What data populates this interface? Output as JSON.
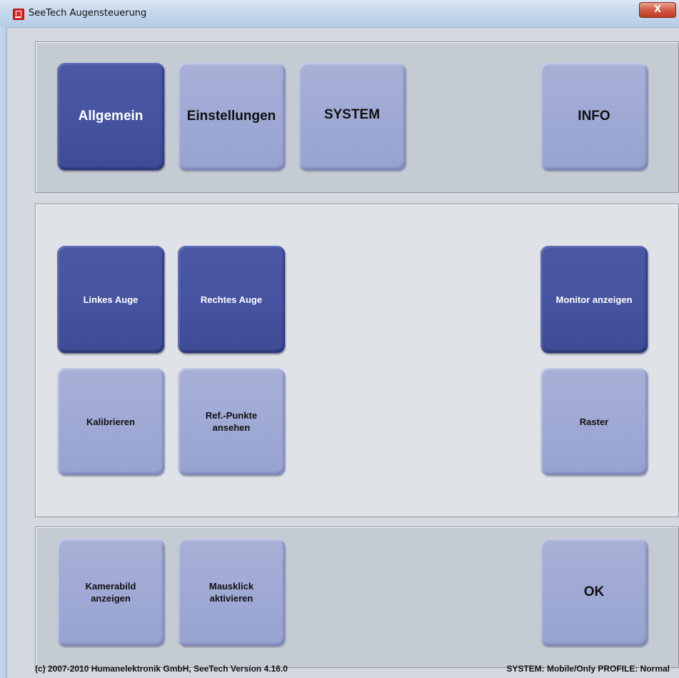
{
  "window": {
    "title": "SeeTech Augensteuerung",
    "close_label": "X"
  },
  "tabs": [
    {
      "label": "Allgemein",
      "active": true
    },
    {
      "label": "Einstellungen",
      "active": false
    },
    {
      "label": "SYSTEM",
      "active": false
    },
    {
      "label": "INFO",
      "active": false
    }
  ],
  "main": {
    "left_eye": "Linkes Auge",
    "right_eye": "Rechtes Auge",
    "monitor": "Monitor anzeigen",
    "calibrate": "Kalibrieren",
    "ref_points": "Ref.-Punkte\nansehen",
    "grid": "Raster"
  },
  "bottom": {
    "camera": "Kamerabild\nanzeigen",
    "mouseclick": "Mausklick\naktivieren",
    "ok": "OK"
  },
  "footer": {
    "copyright": "(c) 2007-2010 Humanelektronik GmbH, SeeTech Version 4.16.0",
    "status": "SYSTEM: Mobile/Only  PROFILE: Normal"
  },
  "colors": {
    "button_active": "#44529f",
    "button_inactive": "#9ea8d4",
    "panel_dark": "#c5cbd3",
    "panel_light": "#dfe3e7"
  }
}
